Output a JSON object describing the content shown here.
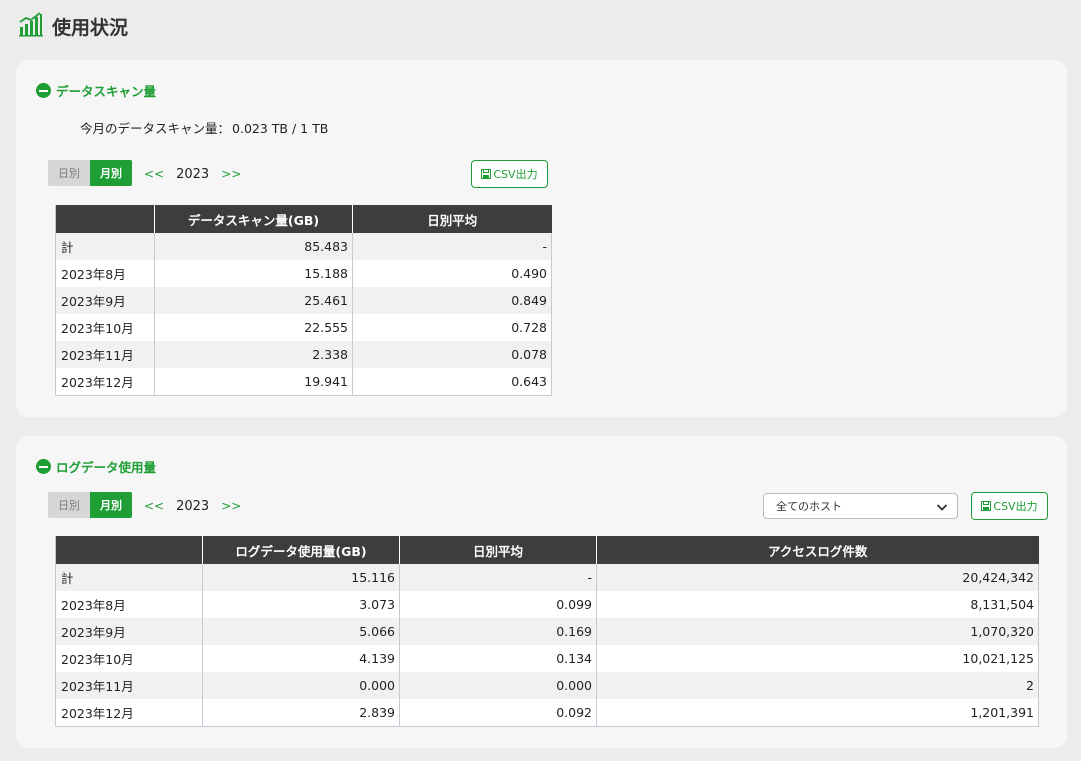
{
  "page": {
    "title": "使用状況"
  },
  "scan_section": {
    "title": "データスキャン量",
    "usage_label": "今月のデータスキャン量：",
    "usage_value": "0.023 TB / 1 TB",
    "toggle": {
      "daily": "日別",
      "monthly": "月別",
      "selected": "monthly"
    },
    "nav": {
      "prev": "<<",
      "year": "2023",
      "next": ">>"
    },
    "csv_label": "CSV出力",
    "table": {
      "headers": [
        "",
        "データスキャン量(GB)",
        "日別平均"
      ],
      "rows": [
        [
          "計",
          "85.483",
          "-"
        ],
        [
          "2023年8月",
          "15.188",
          "0.490"
        ],
        [
          "2023年9月",
          "25.461",
          "0.849"
        ],
        [
          "2023年10月",
          "22.555",
          "0.728"
        ],
        [
          "2023年11月",
          "2.338",
          "0.078"
        ],
        [
          "2023年12月",
          "19.941",
          "0.643"
        ]
      ]
    }
  },
  "log_section": {
    "title": "ログデータ使用量",
    "toggle": {
      "daily": "日別",
      "monthly": "月別",
      "selected": "monthly"
    },
    "nav": {
      "prev": "<<",
      "year": "2023",
      "next": ">>"
    },
    "host_select": {
      "value": "全てのホスト"
    },
    "csv_label": "CSV出力",
    "table": {
      "headers": [
        "",
        "ログデータ使用量(GB)",
        "日別平均",
        "アクセスログ件数"
      ],
      "rows": [
        [
          "計",
          "15.116",
          "-",
          "20,424,342"
        ],
        [
          "2023年8月",
          "3.073",
          "0.099",
          "8,131,504"
        ],
        [
          "2023年9月",
          "5.066",
          "0.169",
          "1,070,320"
        ],
        [
          "2023年10月",
          "4.139",
          "0.134",
          "10,021,125"
        ],
        [
          "2023年11月",
          "0.000",
          "0.000",
          "2"
        ],
        [
          "2023年12月",
          "2.839",
          "0.092",
          "1,201,391"
        ]
      ]
    }
  },
  "colors": {
    "accent": "#1e9e34",
    "header_bg": "#3d3d3d",
    "card_bg": "#f6f6f6",
    "page_bg": "#ececec"
  },
  "icons": {
    "page": "chart-bars-icon",
    "section": "minus-circle-icon",
    "csv": "save-icon",
    "select": "chevron-down-icon"
  }
}
